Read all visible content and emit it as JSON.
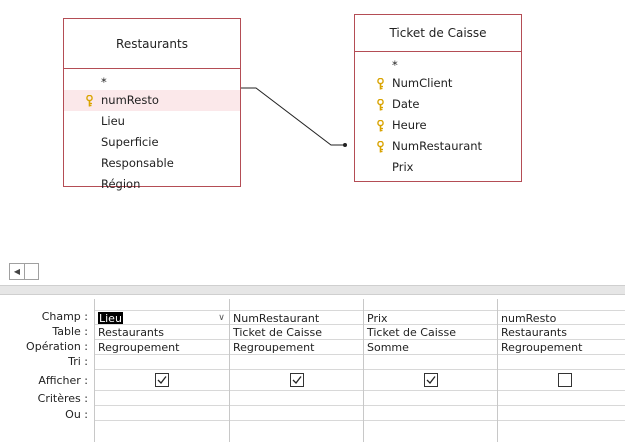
{
  "tables": [
    {
      "title": "Restaurants",
      "fields": [
        {
          "name": "*",
          "key": false
        },
        {
          "name": "numResto",
          "key": true
        },
        {
          "name": "Lieu",
          "key": false
        },
        {
          "name": "Superficie",
          "key": false
        },
        {
          "name": "Responsable",
          "key": false
        },
        {
          "name": "Région",
          "key": false
        }
      ]
    },
    {
      "title": "Ticket de Caisse",
      "fields": [
        {
          "name": "*",
          "key": false
        },
        {
          "name": "NumClient",
          "key": true
        },
        {
          "name": "Date",
          "key": true
        },
        {
          "name": "Heure",
          "key": true
        },
        {
          "name": "NumRestaurant",
          "key": true
        },
        {
          "name": "Prix",
          "key": false
        }
      ]
    }
  ],
  "grid": {
    "row_labels": {
      "champ": "Champ :",
      "table": "Table :",
      "operation": "Opération :",
      "tri": "Tri :",
      "afficher": "Afficher :",
      "criteres": "Critères :",
      "ou": "Ou :"
    },
    "columns": [
      {
        "champ": "Lieu",
        "table": "Restaurants",
        "operation": "Regroupement",
        "afficher": true
      },
      {
        "champ": "NumRestaurant",
        "table": "Ticket de Caisse",
        "operation": "Regroupement",
        "afficher": true
      },
      {
        "champ": "Prix",
        "table": "Ticket de Caisse",
        "operation": "Somme",
        "afficher": true
      },
      {
        "champ": "numResto",
        "table": "Restaurants",
        "operation": "Regroupement",
        "afficher": false
      }
    ]
  },
  "colors": {
    "table_border": "#b44d55",
    "key_icon": "#d9a300",
    "selected_field_bg": "#fbe8ea"
  },
  "icons": {
    "primary_key": "key-icon",
    "combo": "chevron-down-icon",
    "scroll_left": "scroll-left-arrow-icon"
  }
}
